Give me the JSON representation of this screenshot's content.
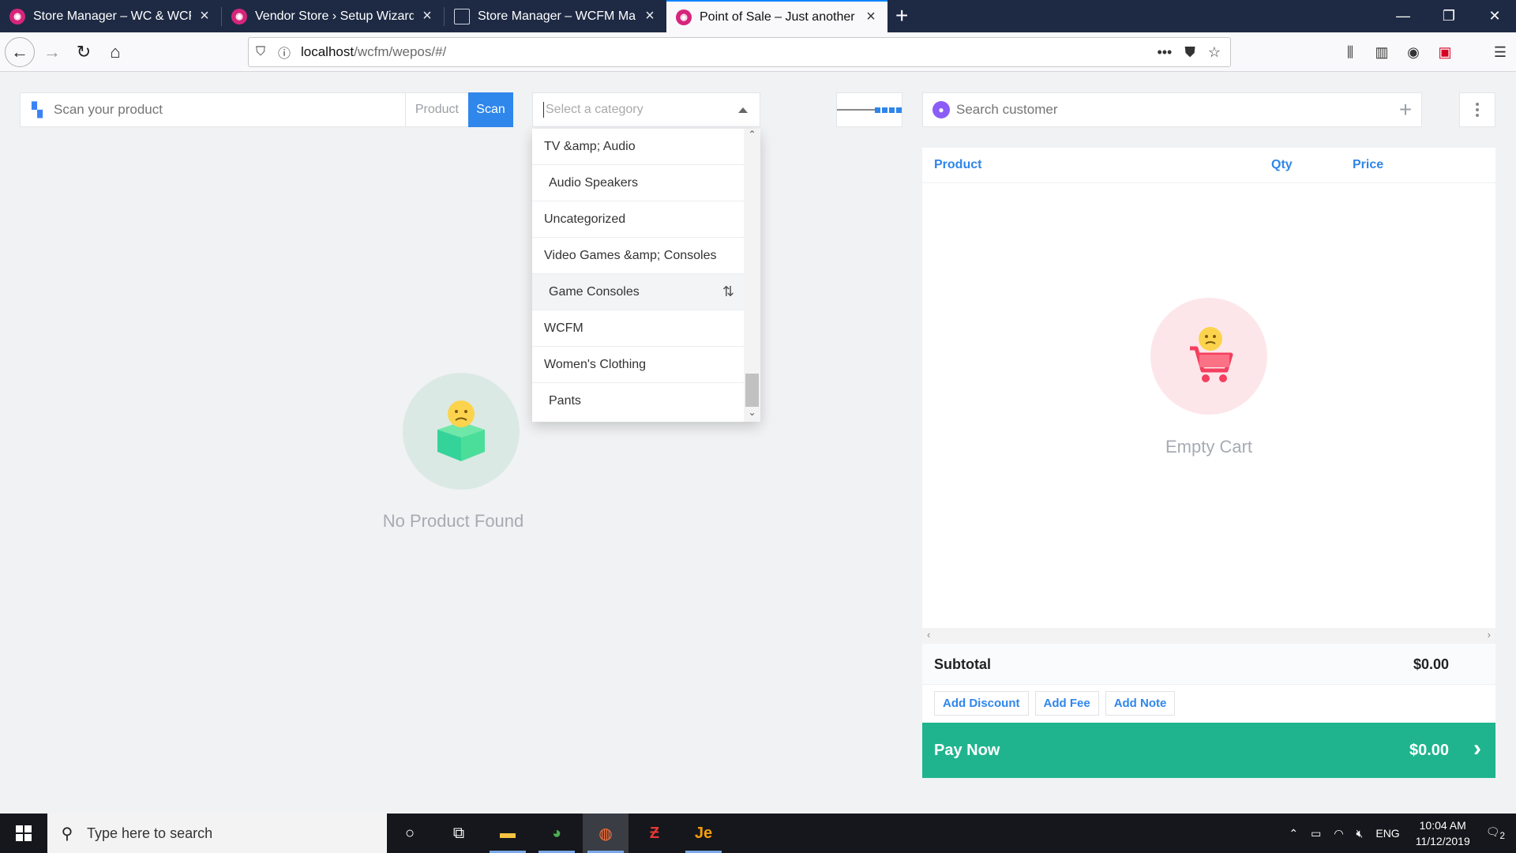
{
  "browser": {
    "tabs": [
      {
        "title": "Store Manager – WC & WCFM",
        "active": false
      },
      {
        "title": "Vendor Store › Setup Wizard",
        "active": false
      },
      {
        "title": "Store Manager – WCFM Marketp",
        "active": false
      },
      {
        "title": "Point of Sale – Just another Wo",
        "active": true
      }
    ],
    "url_host": "localhost",
    "url_path": "/wcfm/wepos/#/"
  },
  "pos": {
    "scan": {
      "placeholder": "Scan your product",
      "mode_label": "Product",
      "button_label": "Scan"
    },
    "category": {
      "placeholder": "Select a category",
      "options": [
        {
          "label": "TV &amp; Audio",
          "child": false
        },
        {
          "label": "Audio Speakers",
          "child": true
        },
        {
          "label": "Uncategorized",
          "child": false
        },
        {
          "label": "Video Games &amp; Consoles",
          "child": false
        },
        {
          "label": "Game Consoles",
          "child": true
        },
        {
          "label": "WCFM",
          "child": false
        },
        {
          "label": "Women's Clothing",
          "child": false
        },
        {
          "label": "Pants",
          "child": true
        }
      ]
    },
    "products_empty_message": "No Product Found",
    "customer": {
      "placeholder": "Search customer"
    },
    "cart": {
      "columns": {
        "product": "Product",
        "qty": "Qty",
        "price": "Price"
      },
      "empty_message": "Empty Cart",
      "subtotal_label": "Subtotal",
      "subtotal_value": "$0.00",
      "actions": [
        "Add Discount",
        "Add Fee",
        "Add Note"
      ],
      "pay_label": "Pay Now",
      "pay_amount": "$0.00"
    }
  },
  "taskbar": {
    "search_placeholder": "Type here to search",
    "language": "ENG",
    "time": "10:04 AM",
    "date": "11/12/2019",
    "notification_count": "2"
  },
  "colors": {
    "accent": "#2f86eb",
    "pay": "#1fb48e",
    "tabbar": "#1e2a44"
  }
}
